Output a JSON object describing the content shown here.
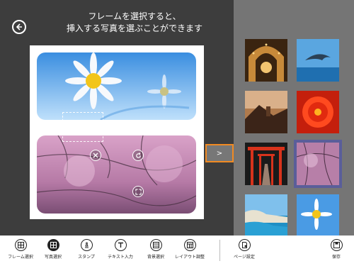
{
  "header": {
    "instruction_line1": "フレームを選択すると、",
    "instruction_line2": "挿入する写真を選ぶことができます"
  },
  "navigation": {
    "next_button_label": ">"
  },
  "icons": {
    "back": "arrow-left-icon",
    "delete": "close-icon",
    "rotate": "rotate-icon",
    "resize": "expand-icon"
  },
  "thumbnails": [
    {
      "name": "thumb-archway",
      "selected": false
    },
    {
      "name": "thumb-dolphin",
      "selected": false
    },
    {
      "name": "thumb-temple-sunset",
      "selected": false
    },
    {
      "name": "thumb-red-flower",
      "selected": false
    },
    {
      "name": "thumb-torii-gates",
      "selected": false
    },
    {
      "name": "thumb-cherry-blossom",
      "selected": true
    },
    {
      "name": "thumb-coast",
      "selected": false
    },
    {
      "name": "thumb-daisy",
      "selected": false
    }
  ],
  "toolbar": {
    "frame_select": "フレーム選択",
    "photo_select": "写真選択",
    "stamp": "スタンプ",
    "text_input": "テキスト入力",
    "background_select": "背景選択",
    "layout_adjust": "レイアウト調整",
    "page_settings": "ページ設定",
    "save": "保存"
  },
  "colors": {
    "accent": "#f08a22",
    "selection": "#5a5e9a",
    "panel": "#757575",
    "main_bg": "#3d3d3d"
  }
}
